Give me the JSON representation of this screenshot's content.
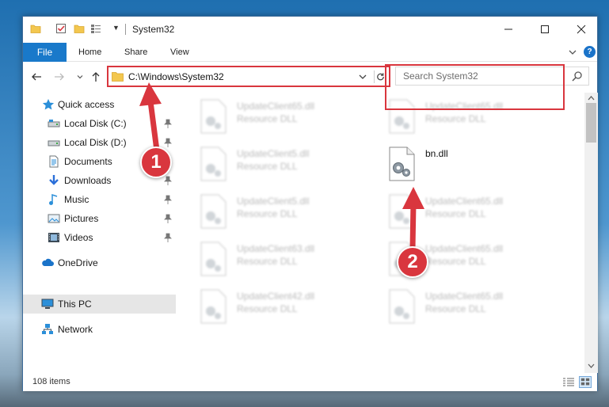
{
  "window": {
    "title": "System32",
    "controls": {
      "minimize": "minimize-icon",
      "maximize": "maximize-icon",
      "close": "close-icon"
    }
  },
  "ribbon": {
    "tabs": [
      {
        "label": "File",
        "active": true
      },
      {
        "label": "Home"
      },
      {
        "label": "Share"
      },
      {
        "label": "View"
      }
    ],
    "help": "?"
  },
  "navigation": {
    "address": "C:\\Windows\\System32",
    "search_placeholder": "Search System32"
  },
  "sidebar": {
    "items": [
      {
        "label": "Quick access",
        "icon": "star-icon"
      },
      {
        "label": "Local Disk (C:)",
        "icon": "drive-icon",
        "pinned": true
      },
      {
        "label": "Local Disk (D:)",
        "icon": "drive-icon",
        "pinned": true
      },
      {
        "label": "Documents",
        "icon": "documents-icon",
        "pinned": true
      },
      {
        "label": "Downloads",
        "icon": "downloads-icon",
        "pinned": true
      },
      {
        "label": "Music",
        "icon": "music-icon",
        "pinned": true
      },
      {
        "label": "Pictures",
        "icon": "pictures-icon",
        "pinned": true
      },
      {
        "label": "Videos",
        "icon": "videos-icon",
        "pinned": true
      },
      {
        "label": "OneDrive",
        "icon": "cloud-icon"
      },
      {
        "label": "This PC",
        "icon": "computer-icon",
        "selected": true
      },
      {
        "label": "Network",
        "icon": "network-icon"
      }
    ]
  },
  "files": {
    "left_column": [
      {
        "name": "UpdateClient65.dll",
        "type": "Resource DLL"
      },
      {
        "name": "UpdateClient5.dll",
        "type": "Resource DLL"
      },
      {
        "name": "UpdateClient5.dll",
        "type": "Resource DLL"
      },
      {
        "name": "UpdateClient63.dll",
        "type": "Resource DLL"
      },
      {
        "name": "UpdateClient42.dll",
        "type": "Resource DLL"
      }
    ],
    "right_column": [
      {
        "name": "UpdateClient65.dll",
        "type": "Resource DLL"
      },
      {
        "name": "bn.dll",
        "type": ""
      },
      {
        "name": "UpdateClient65.dll",
        "type": "Resource DLL"
      },
      {
        "name": "UpdateClient65.dll",
        "type": "Resource DLL"
      },
      {
        "name": "UpdateClient65.dll",
        "type": "Resource DLL"
      }
    ]
  },
  "annotations": {
    "badge_1": "1",
    "badge_2": "2",
    "color": "#d9363e"
  },
  "status": {
    "item_count": "108 items"
  },
  "colors": {
    "accent": "#1979ca",
    "highlight": "#d9363e"
  }
}
